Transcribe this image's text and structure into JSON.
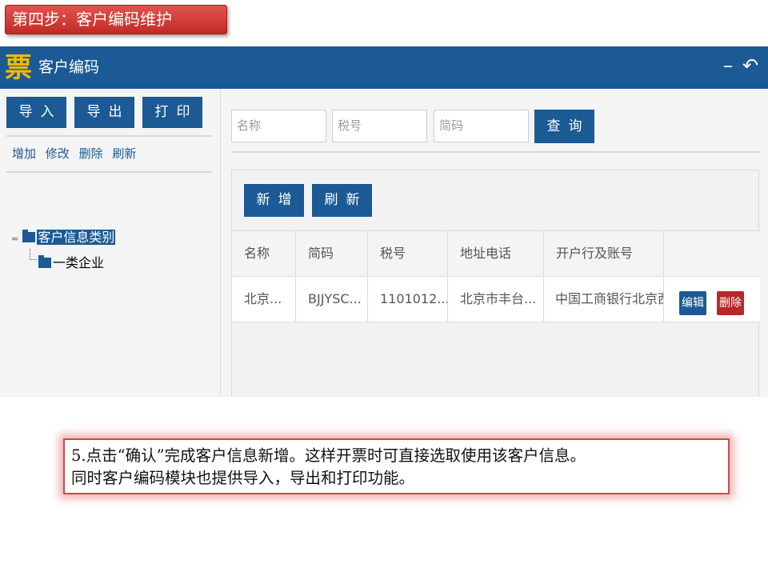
{
  "step_title": "第四步：客户编码维护",
  "app": {
    "logo": "票",
    "title": "客户编码",
    "minimize_icon": "minimize-icon",
    "back_icon": "back-icon",
    "minimize_glyph": "–",
    "back_glyph": "↶"
  },
  "toolbar": {
    "import_label": "导入",
    "export_label": "导出",
    "print_label": "打印"
  },
  "actions": {
    "add": "增加",
    "edit": "修改",
    "delete": "删除",
    "refresh": "刷新"
  },
  "tree": {
    "root_label": "客户信息类别",
    "child_label": "一类企业",
    "collapse_glyph": "≈"
  },
  "search": {
    "name_placeholder": "名称",
    "tax_placeholder": "税号",
    "abbr_placeholder": "简码",
    "query_label": "查询"
  },
  "panel": {
    "new_label": "新增",
    "refresh_label": "刷新"
  },
  "table": {
    "columns": [
      "名称",
      "简码",
      "税号",
      "地址电话",
      "开户行及账号"
    ],
    "rows": [
      {
        "name": "北京...",
        "abbr": "BJJYSC...",
        "tax": "1101012...",
        "address": "北京市丰台...",
        "bank": "中国工商银行北京西...",
        "edit_label": "编辑",
        "delete_label": "删除"
      }
    ]
  },
  "note": {
    "line1": "5.点击“确认”完成客户信息新增。这样开票时可直接选取使用该客户信息。",
    "line2": "同时客户编码模块也提供导入，导出和打印功能。"
  },
  "colors": {
    "primary": "#1b5a94",
    "danger": "#b8282b",
    "title_red": "#c42a25",
    "logo_yellow": "#f2b705"
  }
}
